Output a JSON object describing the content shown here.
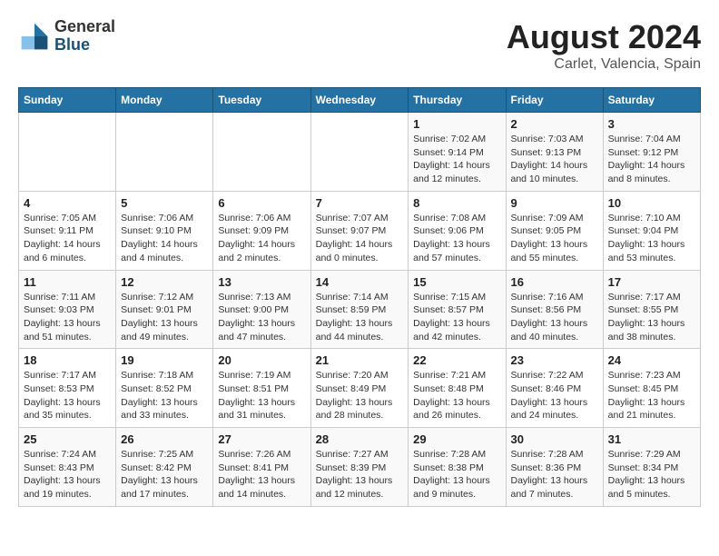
{
  "logo": {
    "general": "General",
    "blue": "Blue"
  },
  "title": "August 2024",
  "subtitle": "Carlet, Valencia, Spain",
  "days_of_week": [
    "Sunday",
    "Monday",
    "Tuesday",
    "Wednesday",
    "Thursday",
    "Friday",
    "Saturday"
  ],
  "weeks": [
    [
      {
        "num": "",
        "info": ""
      },
      {
        "num": "",
        "info": ""
      },
      {
        "num": "",
        "info": ""
      },
      {
        "num": "",
        "info": ""
      },
      {
        "num": "1",
        "info": "Sunrise: 7:02 AM\nSunset: 9:14 PM\nDaylight: 14 hours\nand 12 minutes."
      },
      {
        "num": "2",
        "info": "Sunrise: 7:03 AM\nSunset: 9:13 PM\nDaylight: 14 hours\nand 10 minutes."
      },
      {
        "num": "3",
        "info": "Sunrise: 7:04 AM\nSunset: 9:12 PM\nDaylight: 14 hours\nand 8 minutes."
      }
    ],
    [
      {
        "num": "4",
        "info": "Sunrise: 7:05 AM\nSunset: 9:11 PM\nDaylight: 14 hours\nand 6 minutes."
      },
      {
        "num": "5",
        "info": "Sunrise: 7:06 AM\nSunset: 9:10 PM\nDaylight: 14 hours\nand 4 minutes."
      },
      {
        "num": "6",
        "info": "Sunrise: 7:06 AM\nSunset: 9:09 PM\nDaylight: 14 hours\nand 2 minutes."
      },
      {
        "num": "7",
        "info": "Sunrise: 7:07 AM\nSunset: 9:07 PM\nDaylight: 14 hours\nand 0 minutes."
      },
      {
        "num": "8",
        "info": "Sunrise: 7:08 AM\nSunset: 9:06 PM\nDaylight: 13 hours\nand 57 minutes."
      },
      {
        "num": "9",
        "info": "Sunrise: 7:09 AM\nSunset: 9:05 PM\nDaylight: 13 hours\nand 55 minutes."
      },
      {
        "num": "10",
        "info": "Sunrise: 7:10 AM\nSunset: 9:04 PM\nDaylight: 13 hours\nand 53 minutes."
      }
    ],
    [
      {
        "num": "11",
        "info": "Sunrise: 7:11 AM\nSunset: 9:03 PM\nDaylight: 13 hours\nand 51 minutes."
      },
      {
        "num": "12",
        "info": "Sunrise: 7:12 AM\nSunset: 9:01 PM\nDaylight: 13 hours\nand 49 minutes."
      },
      {
        "num": "13",
        "info": "Sunrise: 7:13 AM\nSunset: 9:00 PM\nDaylight: 13 hours\nand 47 minutes."
      },
      {
        "num": "14",
        "info": "Sunrise: 7:14 AM\nSunset: 8:59 PM\nDaylight: 13 hours\nand 44 minutes."
      },
      {
        "num": "15",
        "info": "Sunrise: 7:15 AM\nSunset: 8:57 PM\nDaylight: 13 hours\nand 42 minutes."
      },
      {
        "num": "16",
        "info": "Sunrise: 7:16 AM\nSunset: 8:56 PM\nDaylight: 13 hours\nand 40 minutes."
      },
      {
        "num": "17",
        "info": "Sunrise: 7:17 AM\nSunset: 8:55 PM\nDaylight: 13 hours\nand 38 minutes."
      }
    ],
    [
      {
        "num": "18",
        "info": "Sunrise: 7:17 AM\nSunset: 8:53 PM\nDaylight: 13 hours\nand 35 minutes."
      },
      {
        "num": "19",
        "info": "Sunrise: 7:18 AM\nSunset: 8:52 PM\nDaylight: 13 hours\nand 33 minutes."
      },
      {
        "num": "20",
        "info": "Sunrise: 7:19 AM\nSunset: 8:51 PM\nDaylight: 13 hours\nand 31 minutes."
      },
      {
        "num": "21",
        "info": "Sunrise: 7:20 AM\nSunset: 8:49 PM\nDaylight: 13 hours\nand 28 minutes."
      },
      {
        "num": "22",
        "info": "Sunrise: 7:21 AM\nSunset: 8:48 PM\nDaylight: 13 hours\nand 26 minutes."
      },
      {
        "num": "23",
        "info": "Sunrise: 7:22 AM\nSunset: 8:46 PM\nDaylight: 13 hours\nand 24 minutes."
      },
      {
        "num": "24",
        "info": "Sunrise: 7:23 AM\nSunset: 8:45 PM\nDaylight: 13 hours\nand 21 minutes."
      }
    ],
    [
      {
        "num": "25",
        "info": "Sunrise: 7:24 AM\nSunset: 8:43 PM\nDaylight: 13 hours\nand 19 minutes."
      },
      {
        "num": "26",
        "info": "Sunrise: 7:25 AM\nSunset: 8:42 PM\nDaylight: 13 hours\nand 17 minutes."
      },
      {
        "num": "27",
        "info": "Sunrise: 7:26 AM\nSunset: 8:41 PM\nDaylight: 13 hours\nand 14 minutes."
      },
      {
        "num": "28",
        "info": "Sunrise: 7:27 AM\nSunset: 8:39 PM\nDaylight: 13 hours\nand 12 minutes."
      },
      {
        "num": "29",
        "info": "Sunrise: 7:28 AM\nSunset: 8:38 PM\nDaylight: 13 hours\nand 9 minutes."
      },
      {
        "num": "30",
        "info": "Sunrise: 7:28 AM\nSunset: 8:36 PM\nDaylight: 13 hours\nand 7 minutes."
      },
      {
        "num": "31",
        "info": "Sunrise: 7:29 AM\nSunset: 8:34 PM\nDaylight: 13 hours\nand 5 minutes."
      }
    ]
  ]
}
